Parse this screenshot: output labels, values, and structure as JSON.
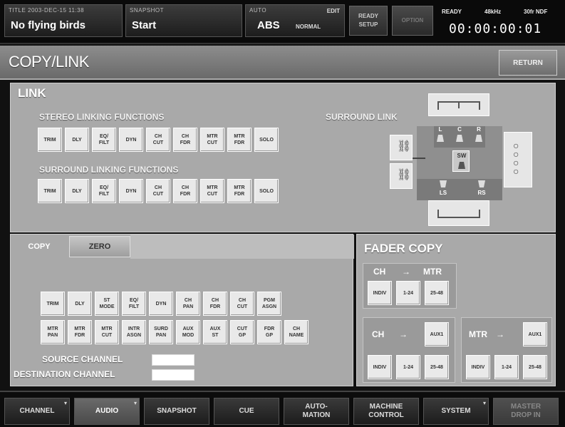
{
  "topbar": {
    "title_label": "TITLE 2003-DEC-15 11:38",
    "title_value": "No flying birds",
    "snapshot_label": "SNAPSHOT",
    "snapshot_value": "Start",
    "auto_label": "AUTO",
    "auto_value": "ABS",
    "auto_edit": "EDIT",
    "auto_mode": "NORMAL",
    "ready_setup": "READY\nSETUP",
    "option": "OPTION",
    "status": "READY",
    "rate": "48kHz",
    "fps": "30fr NDF",
    "timecode": "00:00:00:01"
  },
  "page": {
    "title": "COPY/LINK",
    "return_label": "RETURN"
  },
  "link": {
    "title": "LINK",
    "stereo_label": "STEREO LINKING FUNCTIONS",
    "surround_label": "SURROUND LINKING FUNCTIONS",
    "surround_link_label": "SURROUND LINK",
    "stereo_buttons": [
      "TRIM",
      "DLY",
      "EQ/\nFILT",
      "DYN",
      "CH\nCUT",
      "CH\nFDR",
      "MTR\nCUT",
      "MTR\nFDR",
      "SOLO"
    ],
    "surround_buttons": [
      "TRIM",
      "DLY",
      "EQ/\nFILT",
      "DYN",
      "CH\nCUT",
      "CH\nFDR",
      "MTR\nCUT",
      "MTR\nFDR",
      "SOLO"
    ],
    "speakers": {
      "l": "L",
      "c": "C",
      "r": "R",
      "sw": "SW",
      "ls": "LS",
      "rs": "RS"
    }
  },
  "copy": {
    "tab_copy": "COPY",
    "tab_zero": "ZERO",
    "row1": [
      "TRIM",
      "DLY",
      "ST\nMODE",
      "EQ/\nFILT",
      "DYN",
      "CH\nPAN",
      "CH\nFDR",
      "CH\nCUT",
      "PGM\nASGN"
    ],
    "row2": [
      "MTR\nPAN",
      "MTR\nFDR",
      "MTR\nCUT",
      "INTR\nASGN",
      "SURD\nPAN",
      "AUX\nMOD",
      "AUX\nST",
      "CUT\nGP",
      "FDR\nGP",
      "CH\nNAME"
    ],
    "source_label": "SOURCE CHANNEL",
    "destination_label": "DESTINATION CHANNEL"
  },
  "fader_copy": {
    "title": "FADER COPY",
    "ch_label": "CH",
    "mtr_label": "MTR",
    "arrow": "→",
    "top_buttons": [
      "INDIV",
      "1-24",
      "25-48"
    ],
    "ch_aux": "AUX1",
    "mtr_aux": "AUX1",
    "ch_buttons": [
      "INDIV",
      "1-24",
      "25-48"
    ],
    "mtr_buttons": [
      "INDIV",
      "1-24",
      "25-48"
    ]
  },
  "nav": {
    "items": [
      "CHANNEL",
      "AUDIO",
      "SNAPSHOT",
      "CUE",
      "AUTO-\nMATION",
      "MACHINE\nCONTROL",
      "SYSTEM",
      "MASTER\nDROP IN"
    ],
    "active": "AUDIO"
  }
}
